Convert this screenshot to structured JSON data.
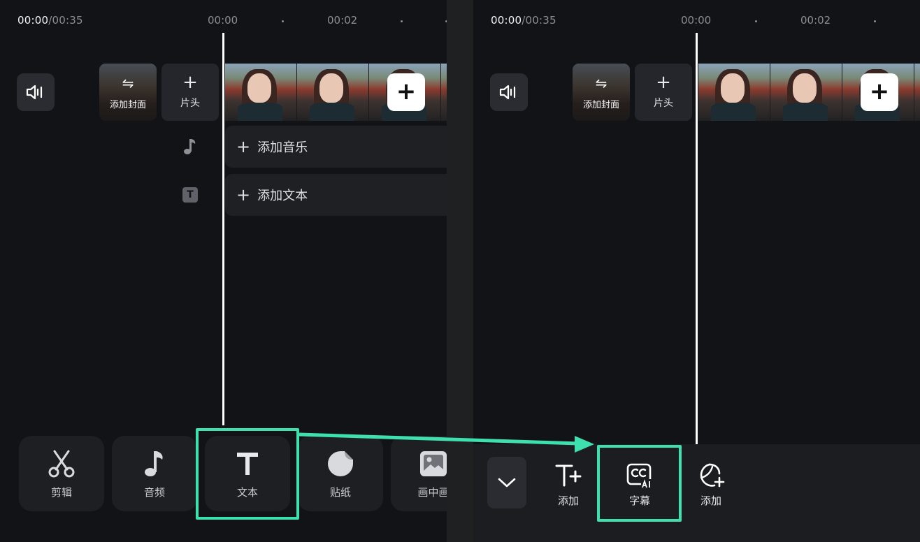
{
  "left": {
    "timecode_current": "00:00",
    "timecode_total": "/00:35",
    "ruler_ticks": [
      "00:00",
      "00:02"
    ],
    "cover_label": "添加封面",
    "cover_swap_symbol": "⇋",
    "intro_plus": "+",
    "intro_label": "片头",
    "add_clip_symbol": "+",
    "add_music_label": "添加音乐",
    "add_text_label": "添加文本",
    "track_add_symbol": "+",
    "text_track_icon_glyph": "T",
    "tools": [
      {
        "label": "剪辑",
        "icon": "scissors-icon"
      },
      {
        "label": "音频",
        "icon": "music-note-icon"
      },
      {
        "label": "文本",
        "icon": "text-t-icon"
      },
      {
        "label": "贴纸",
        "icon": "sticker-icon"
      },
      {
        "label": "画中画",
        "icon": "picture-in-picture-icon"
      }
    ]
  },
  "right": {
    "timecode_current": "00:00",
    "timecode_total": "/00:35",
    "ruler_ticks": [
      "00:00",
      "00:02"
    ],
    "cover_label": "添加封面",
    "cover_swap_symbol": "⇋",
    "intro_plus": "+",
    "intro_label": "片头",
    "add_clip_symbol": "+",
    "sub_tools": [
      {
        "label": "添加",
        "icon": "add-text-icon"
      },
      {
        "label": "字幕",
        "icon": "ai-caption-icon"
      },
      {
        "label": "添加",
        "icon": "add-sticker-icon"
      }
    ]
  },
  "colors": {
    "background": "#121317",
    "highlight": "#3fe0b0",
    "playhead": "#ffffff"
  }
}
